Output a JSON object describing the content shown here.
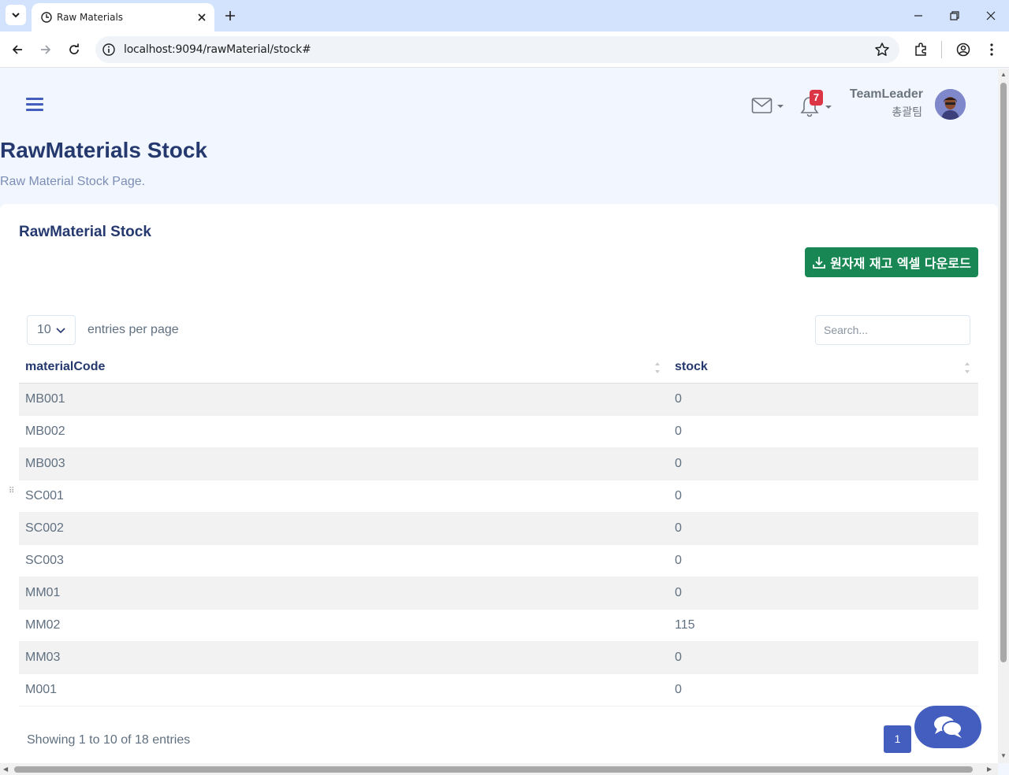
{
  "browser": {
    "tab_title": "Raw Materials",
    "url": "localhost:9094/rawMaterial/stock#"
  },
  "header": {
    "notification_count": "7",
    "user_name": "TeamLeader",
    "user_team": "총괄팀"
  },
  "page": {
    "title": "RawMaterials Stock",
    "subtitle": "Raw Material Stock Page."
  },
  "card": {
    "title": "RawMaterial Stock",
    "excel_button_label": "원자재 재고 엑셀 다운로드",
    "per_page_value": "10",
    "per_page_label": "entries per page",
    "search_placeholder": "Search...",
    "columns": [
      "materialCode",
      "stock"
    ],
    "rows": [
      [
        "MB001",
        "0"
      ],
      [
        "MB002",
        "0"
      ],
      [
        "MB003",
        "0"
      ],
      [
        "SC001",
        "0"
      ],
      [
        "SC002",
        "0"
      ],
      [
        "SC003",
        "0"
      ],
      [
        "MM01",
        "0"
      ],
      [
        "MM02",
        "115"
      ],
      [
        "MM03",
        "0"
      ],
      [
        "M001",
        "0"
      ]
    ],
    "info_text": "Showing 1 to 10 of 18 entries",
    "current_page": "1"
  },
  "colors": {
    "primary": "#435ebe",
    "success": "#198754",
    "badge": "#dc3545",
    "page_bg": "#f2f7ff"
  }
}
